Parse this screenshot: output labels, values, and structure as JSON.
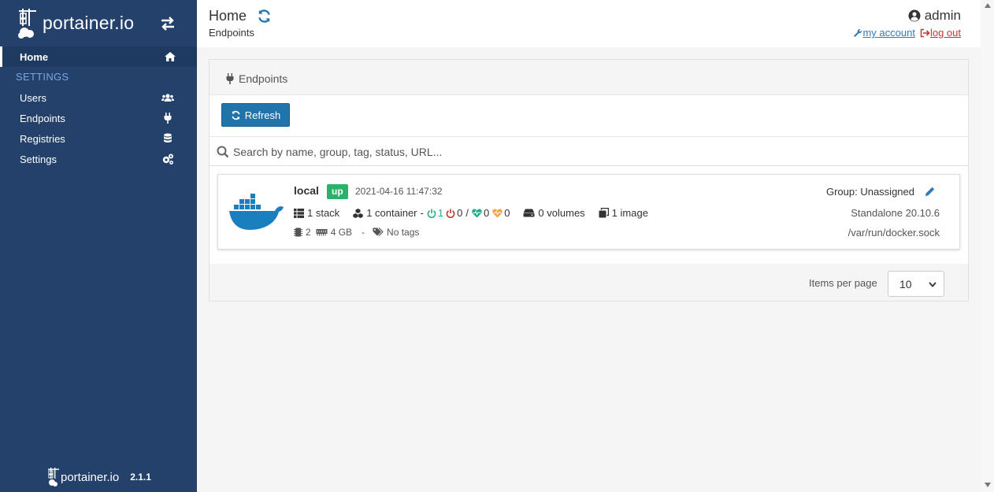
{
  "sidebar": {
    "brand": "portainer.io",
    "items": [
      {
        "label": "Home"
      },
      {
        "label": "Users"
      },
      {
        "label": "Endpoints"
      },
      {
        "label": "Registries"
      },
      {
        "label": "Settings"
      }
    ],
    "section_label": "SETTINGS",
    "footer_brand": "portainer.io",
    "version": "2.1.1"
  },
  "header": {
    "title": "Home",
    "breadcrumb": "Endpoints",
    "user": "admin",
    "my_account": "my account",
    "log_out": "log out"
  },
  "widget": {
    "title": "Endpoints",
    "refresh_label": "Refresh",
    "search_placeholder": "Search by name, group, tag, status, URL...",
    "items_per_page_label": "Items per page",
    "items_per_page_value": "10"
  },
  "endpoint": {
    "name": "local",
    "status": "up",
    "timestamp": "2021-04-16 11:47:32",
    "stacks": "1 stack",
    "containers": "1 container",
    "dash": "-",
    "running": "1",
    "stopped": "0",
    "slash": "/",
    "healthy": "0",
    "unhealthy": "0",
    "volumes": "0 volumes",
    "images": "1 image",
    "cpu": "2",
    "memory": "4 GB",
    "tags_dash": "-",
    "tags": "No tags",
    "group": "Group: Unassigned",
    "version": "Standalone 20.10.6",
    "socket": "/var/run/docker.sock"
  },
  "colors": {
    "sidebar": "#23416b",
    "accent": "#2174a9",
    "status_up": "#2ab26a",
    "running": "#23ae89",
    "stopped": "#c0392b",
    "unhealthy": "#f2a346"
  }
}
